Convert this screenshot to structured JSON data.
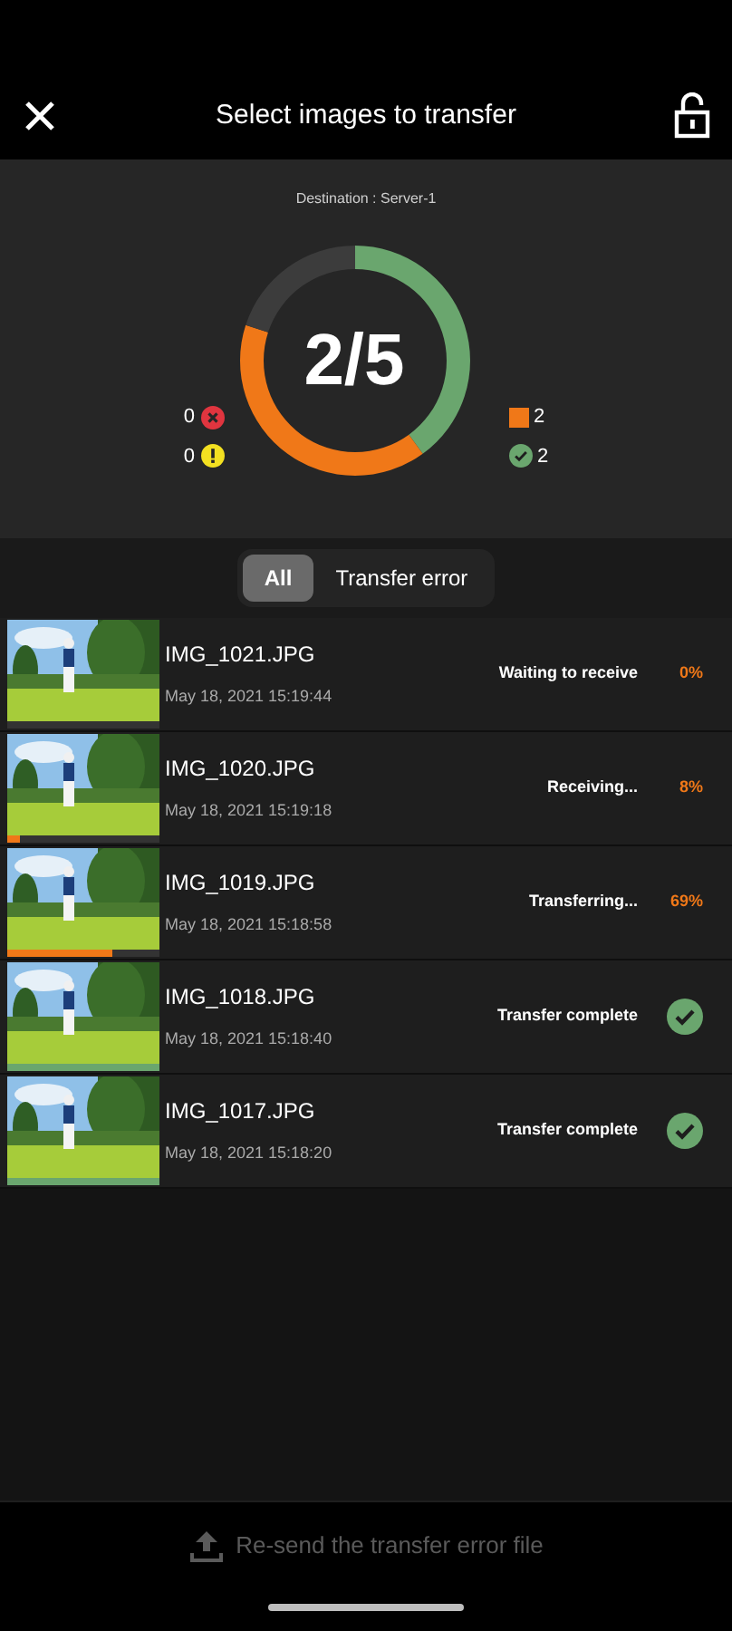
{
  "header": {
    "title": "Select images to transfer"
  },
  "summary": {
    "destination": "Destination : Server-1",
    "count": "2/5",
    "chart_data": {
      "type": "donut",
      "values": [
        40,
        40,
        20
      ],
      "colors": [
        "#6aa66e",
        "#f07818",
        "#3c3c3c"
      ]
    },
    "left_legend": [
      {
        "kind": "error",
        "value": "0"
      },
      {
        "kind": "warning",
        "value": "0"
      }
    ],
    "right_legend": [
      {
        "kind": "transferring",
        "value": "2"
      },
      {
        "kind": "complete",
        "value": "2"
      }
    ]
  },
  "tabs": [
    {
      "label": "All",
      "selected": true
    },
    {
      "label": "Transfer error",
      "selected": false
    }
  ],
  "files": [
    {
      "name": "IMG_1021.JPG",
      "date": "May 18, 2021 15:19:44",
      "status": "Waiting to receive",
      "kind": "percent",
      "percent": "0%"
    },
    {
      "name": "IMG_1020.JPG",
      "date": "May 18, 2021 15:19:18",
      "status": "Receiving...",
      "kind": "percent",
      "percent": "8%",
      "level": 0.08
    },
    {
      "name": "IMG_1019.JPG",
      "date": "May 18, 2021 15:18:58",
      "status": "Transferring...",
      "kind": "percent",
      "percent": "69%",
      "level": 0.69
    },
    {
      "name": "IMG_1018.JPG",
      "date": "May 18, 2021 15:18:40",
      "status": "Transfer complete",
      "kind": "complete",
      "level": 1
    },
    {
      "name": "IMG_1017.JPG",
      "date": "May 18, 2021 15:18:20",
      "status": "Transfer complete",
      "kind": "complete",
      "level": 1
    }
  ],
  "footer": {
    "button": "Re-send the transfer error file",
    "disabled": true
  }
}
